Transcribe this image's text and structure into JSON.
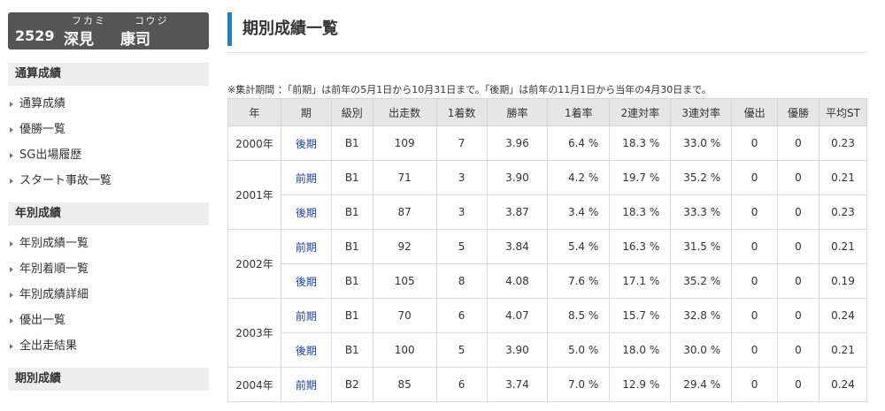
{
  "racer": {
    "id": "2529",
    "family_name": "深見",
    "given_name": "康司",
    "family_ruby": "フカミ",
    "given_ruby": "コウジ"
  },
  "sidebar": {
    "sections": [
      {
        "title": "通算成績",
        "items": [
          "通算成績",
          "優勝一覧",
          "SG出場履歴",
          "スタート事故一覧"
        ]
      },
      {
        "title": "年別成績",
        "items": [
          "年別成績一覧",
          "年別着順一覧",
          "年別成績詳細",
          "優出一覧",
          "全出走結果"
        ]
      },
      {
        "title": "期別成績",
        "items": []
      }
    ]
  },
  "main": {
    "title": "期別成績一覧",
    "note": "※集計期間 ：「前期」は前年の5月1日から10月31日まで。「後期」は前年の11月1日から当年の4月30日まで。"
  },
  "table": {
    "headers": [
      "年",
      "期",
      "級別",
      "出走数",
      "1着数",
      "勝率",
      "1着率",
      "2連対率",
      "3連対率",
      "優出",
      "優勝",
      "平均ST"
    ],
    "rows": [
      {
        "year": "2000年",
        "term": "後期",
        "class": "B1",
        "starts": "109",
        "wins": "7",
        "win_rate": "3.96",
        "first_rate": "6.4 %",
        "second_rate": "18.3 %",
        "third_rate": "33.0 %",
        "finals": "0",
        "victories": "0",
        "avg_st": "0.23"
      },
      {
        "year": "2001年",
        "term": "前期",
        "class": "B1",
        "starts": "71",
        "wins": "3",
        "win_rate": "3.90",
        "first_rate": "4.2 %",
        "second_rate": "19.7 %",
        "third_rate": "35.2 %",
        "finals": "0",
        "victories": "0",
        "avg_st": "0.21"
      },
      {
        "year": "",
        "term": "後期",
        "class": "B1",
        "starts": "87",
        "wins": "3",
        "win_rate": "3.87",
        "first_rate": "3.4 %",
        "second_rate": "18.3 %",
        "third_rate": "33.3 %",
        "finals": "0",
        "victories": "0",
        "avg_st": "0.23"
      },
      {
        "year": "2002年",
        "term": "前期",
        "class": "B1",
        "starts": "92",
        "wins": "5",
        "win_rate": "3.84",
        "first_rate": "5.4 %",
        "second_rate": "16.3 %",
        "third_rate": "31.5 %",
        "finals": "0",
        "victories": "0",
        "avg_st": "0.21"
      },
      {
        "year": "",
        "term": "後期",
        "class": "B1",
        "starts": "105",
        "wins": "8",
        "win_rate": "4.08",
        "first_rate": "7.6 %",
        "second_rate": "17.1 %",
        "third_rate": "35.2 %",
        "finals": "0",
        "victories": "0",
        "avg_st": "0.19"
      },
      {
        "year": "2003年",
        "term": "前期",
        "class": "B1",
        "starts": "70",
        "wins": "6",
        "win_rate": "4.07",
        "first_rate": "8.5 %",
        "second_rate": "15.7 %",
        "third_rate": "32.8 %",
        "finals": "0",
        "victories": "0",
        "avg_st": "0.24"
      },
      {
        "year": "",
        "term": "後期",
        "class": "B1",
        "starts": "100",
        "wins": "5",
        "win_rate": "3.90",
        "first_rate": "5.0 %",
        "second_rate": "18.0 %",
        "third_rate": "30.0 %",
        "finals": "0",
        "victories": "0",
        "avg_st": "0.21"
      },
      {
        "year": "2004年",
        "term": "前期",
        "class": "B2",
        "starts": "85",
        "wins": "6",
        "win_rate": "3.74",
        "first_rate": "7.0 %",
        "second_rate": "12.9 %",
        "third_rate": "29.4 %",
        "finals": "0",
        "victories": "0",
        "avg_st": "0.24"
      }
    ]
  },
  "colors": {
    "accent": "#1a7fd1",
    "link": "#1a3fb0",
    "racer_box": "#555555",
    "section_bg": "#eeeeee",
    "header_bg": "#e6e6e6"
  }
}
